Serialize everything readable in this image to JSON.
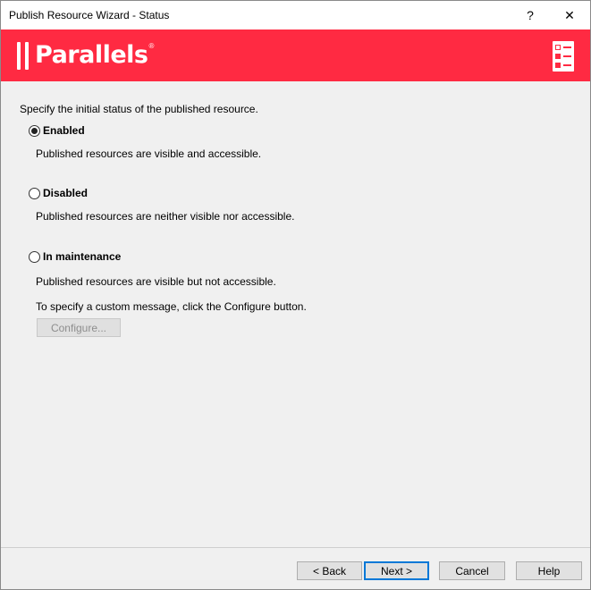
{
  "window": {
    "title": "Publish Resource Wizard - Status",
    "help_glyph": "?",
    "close_glyph": "✕"
  },
  "banner": {
    "brand": "Parallels",
    "reg_mark": "®",
    "color": "#ff2a42",
    "right_icon": "checklist-icon"
  },
  "content": {
    "instruction": "Specify the initial status of the published resource.",
    "options": [
      {
        "label": "Enabled",
        "description": "Published resources are visible and accessible.",
        "selected": true
      },
      {
        "label": "Disabled",
        "description": "Published resources are neither visible nor accessible.",
        "selected": false
      },
      {
        "label": "In maintenance",
        "description": "Published resources are visible but not accessible.",
        "selected": false
      }
    ],
    "custom_message_hint": "To specify a custom message, click the Configure button.",
    "configure_label": "Configure..."
  },
  "footer": {
    "back_label": "< Back",
    "next_label": "Next >",
    "cancel_label": "Cancel",
    "help_label": "Help"
  }
}
